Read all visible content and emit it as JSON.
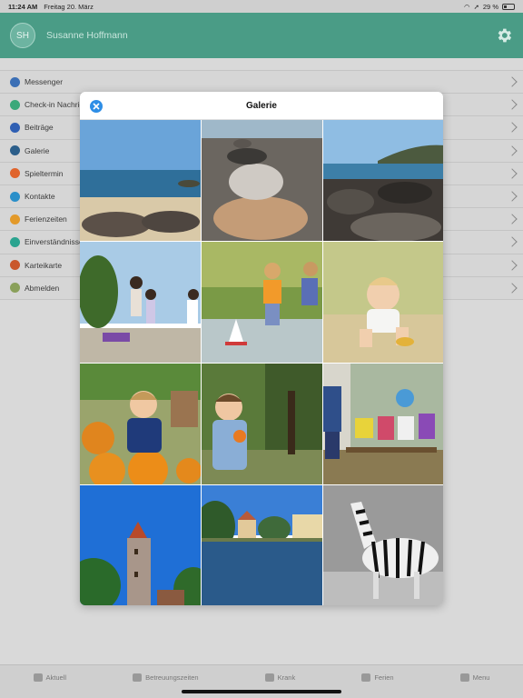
{
  "status": {
    "time": "11:24 AM",
    "date": "Freitag 20. März",
    "battery": "29 %"
  },
  "header": {
    "initials": "SH",
    "name": "Susanne Hoffmann"
  },
  "menu": {
    "items": [
      {
        "label": "Messenger",
        "color": "#3b6fb5"
      },
      {
        "label": "Check-in Nachric",
        "color": "#3aa87a"
      },
      {
        "label": "Beiträge",
        "color": "#2f5fb3"
      },
      {
        "label": "Galerie",
        "color": "#2b5e8a"
      },
      {
        "label": "Spieltermin",
        "color": "#e0642c"
      },
      {
        "label": "Kontakte",
        "color": "#2a8fc9"
      },
      {
        "label": "Ferienzeiten",
        "color": "#e39a2a"
      },
      {
        "label": "Einverständnisse",
        "color": "#2aa38f"
      },
      {
        "label": "Karteikarte",
        "color": "#c9572b"
      },
      {
        "label": "Abmelden",
        "color": "#8aa05a"
      }
    ]
  },
  "modal": {
    "title": "Galerie"
  },
  "gallery": {
    "photos": [
      "beach-with-rocks",
      "stacked-stones",
      "rocky-coast",
      "children-playing-outside",
      "children-splashing-water",
      "toddler-crawling",
      "boy-with-pumpkins",
      "toddler-eating-fruit",
      "children-in-forest",
      "tower",
      "river-town",
      "zebra"
    ]
  },
  "tabbar": {
    "tabs": [
      {
        "label": "Aktuell",
        "icon": "news-icon"
      },
      {
        "label": "Betreuungszeiten",
        "icon": "clock-icon"
      },
      {
        "label": "Krank",
        "icon": "thermometer-icon"
      },
      {
        "label": "Ferien",
        "icon": "plane-icon"
      },
      {
        "label": "Menu",
        "icon": "menu-icon"
      }
    ]
  }
}
